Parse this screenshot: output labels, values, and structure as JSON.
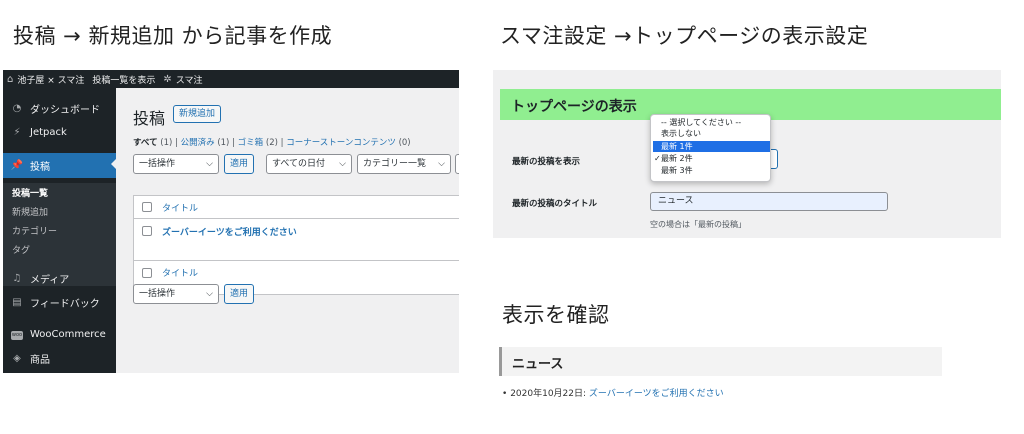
{
  "headings": {
    "left": "投稿 → 新規追加 から記事を作成",
    "right": "スマ注設定 →トップページの表示設定",
    "confirm": "表示を確認"
  },
  "wp": {
    "adminbar": {
      "site": "池子屋 × スマ注",
      "view_posts": "投稿一覧を表示",
      "plugin": "スマ注"
    },
    "sidebar": {
      "dashboard": "ダッシュボード",
      "jetpack": "Jetpack",
      "posts": "投稿",
      "sub": [
        "投稿一覧",
        "新規追加",
        "カテゴリー",
        "タグ"
      ],
      "media": "メディア",
      "feedback": "フィードバック",
      "woocommerce": "WooCommerce",
      "products": "商品"
    },
    "page_title": "投稿",
    "add_new": "新規追加",
    "status": {
      "all": "すべて",
      "all_count": "(1)",
      "published": "公開済み",
      "published_count": "(1)",
      "trash": "ゴミ箱",
      "trash_count": "(2)",
      "cornerstone": "コーナーストーンコンテンツ",
      "cornerstone_count": "(0)"
    },
    "bulk_action": "一括操作",
    "apply": "適用",
    "all_dates": "すべての日付",
    "all_categories": "カテゴリー一覧",
    "table": {
      "col_title": "タイトル",
      "post_title": "ズーバーイーツをご利用ください"
    }
  },
  "settings": {
    "title": "トップページの表示",
    "label_show": "最新の投稿を表示",
    "label_title": "最新の投稿のタイトル",
    "options": [
      "-- 選択してください --",
      "表示しない",
      "最新 1件",
      "最新 2件",
      "最新 3件"
    ],
    "highlighted_option": "最新 1件",
    "checked_option": "最新 2件",
    "title_value": "ニュース",
    "hint": "空の場合は「最新の投稿」"
  },
  "preview": {
    "heading": "ニュース",
    "date": "2020年10月22日:",
    "link": "ズーバーイーツをご利用ください"
  }
}
